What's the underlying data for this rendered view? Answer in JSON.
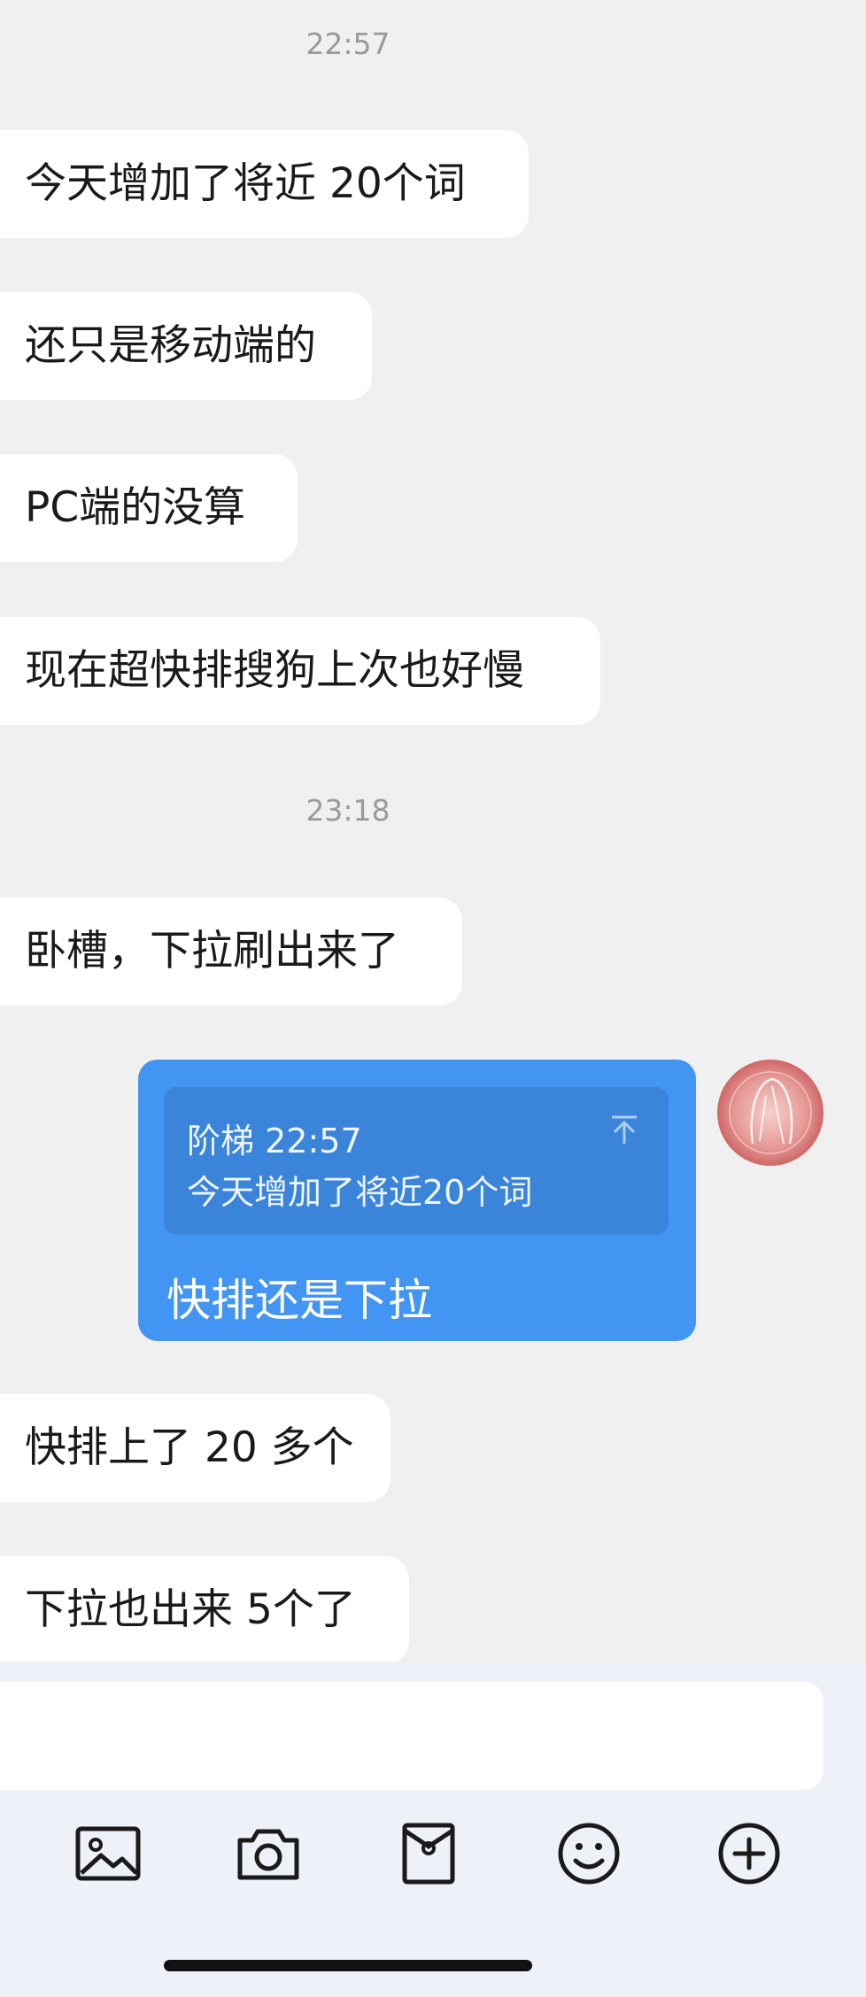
{
  "messages": [
    {
      "type": "time",
      "text": "22:57"
    },
    {
      "type": "in",
      "text": "今天增加了将近 20个词"
    },
    {
      "type": "in",
      "text": "还只是移动端的"
    },
    {
      "type": "in",
      "text": "PC端的没算"
    },
    {
      "type": "in",
      "text": "现在超快排搜狗上次也好慢"
    },
    {
      "type": "time",
      "text": "23:18"
    },
    {
      "type": "in",
      "text": "卧槽，下拉刷出来了"
    },
    {
      "type": "out",
      "quote": {
        "sender": "阶梯",
        "time": "22:57",
        "text": "今天增加了将近20个词"
      },
      "text": "快排还是下拉"
    },
    {
      "type": "in",
      "text": "快排上了 20 多个"
    },
    {
      "type": "in",
      "text": "下拉也出来 5个了"
    }
  ],
  "input": {
    "value": ""
  },
  "toolbar": [
    "image-icon",
    "camera-icon",
    "red-packet-icon",
    "emoji-icon",
    "plus-icon"
  ],
  "colors": {
    "my_bubble": "#4295f2",
    "quote_bg": "#3a84da",
    "chat_bg": "#f0f0f0"
  }
}
